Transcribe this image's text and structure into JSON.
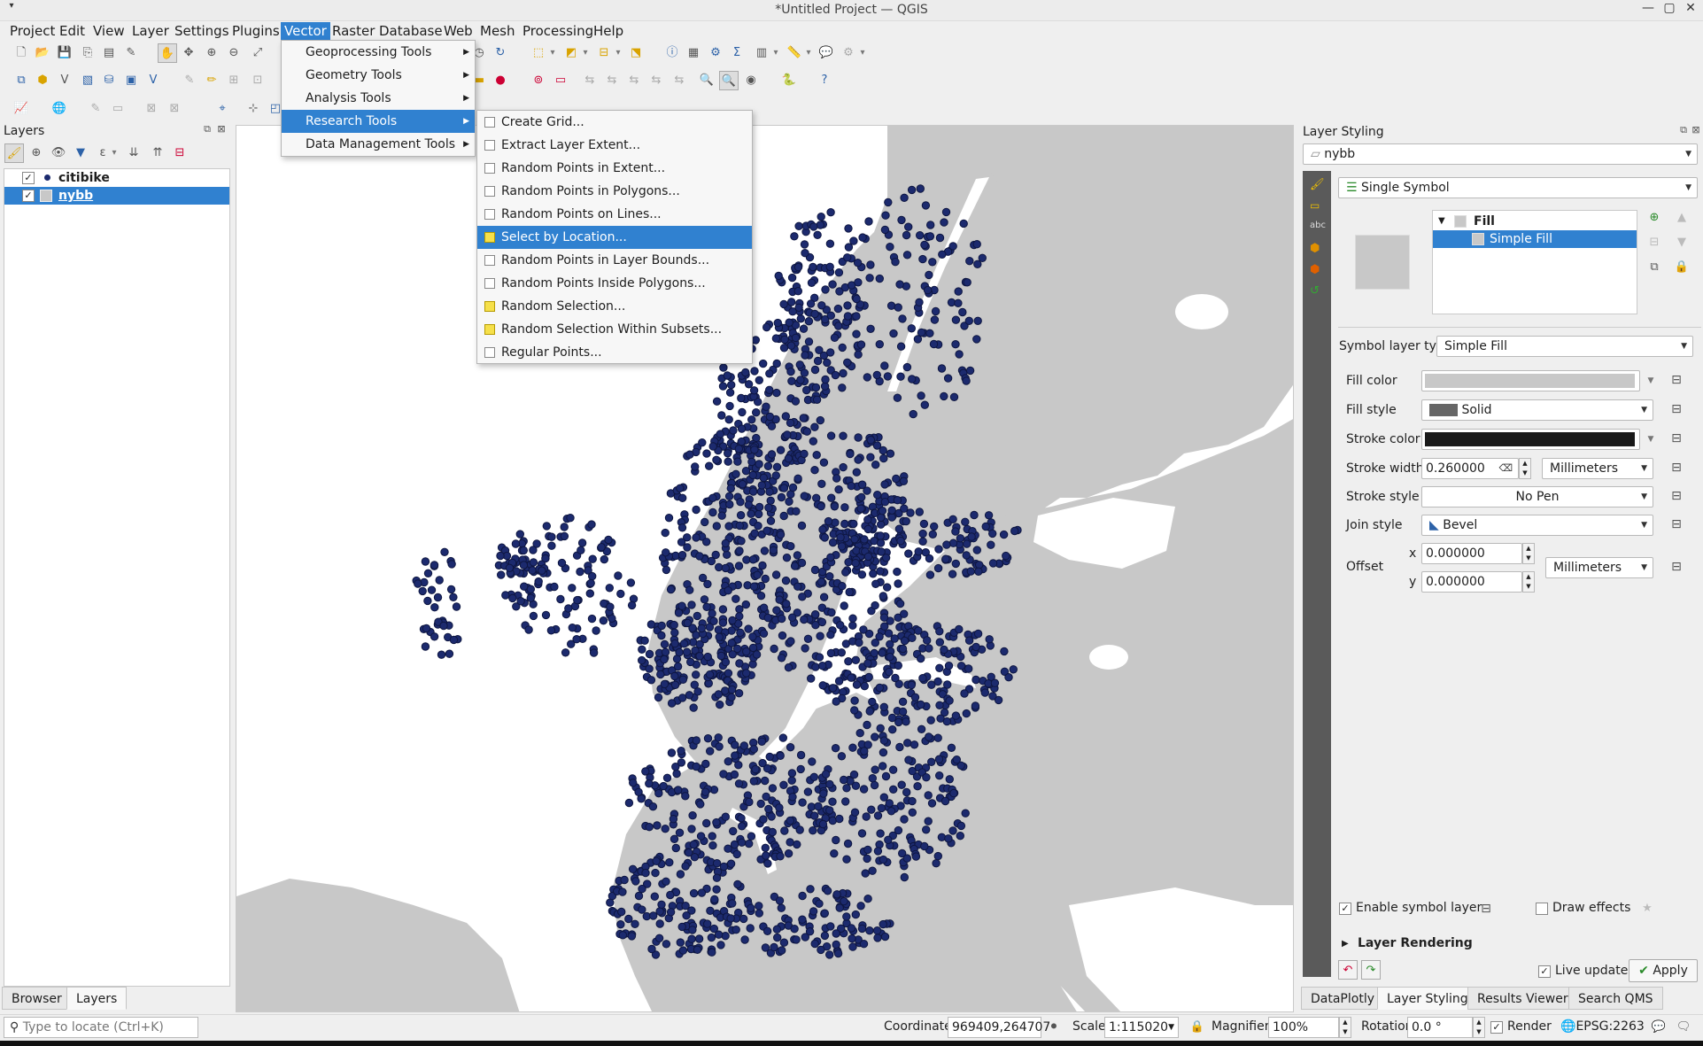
{
  "window": {
    "title": "*Untitled Project — QGIS",
    "menu_icon": "chevron-down-icon",
    "minimize": "—",
    "maximize": "▢",
    "close": "✕"
  },
  "menubar": [
    "Project",
    "Edit",
    "View",
    "Layer",
    "Settings",
    "Plugins",
    "Vector",
    "Raster",
    "Database",
    "Web",
    "Mesh",
    "Processing",
    "Help"
  ],
  "vector_menu": {
    "items": [
      "Geoprocessing Tools",
      "Geometry Tools",
      "Analysis Tools",
      "Research Tools",
      "Data Management Tools"
    ],
    "highlighted": "Research Tools"
  },
  "research_submenu": {
    "items": [
      "Create Grid...",
      "Extract Layer Extent...",
      "Random Points in Extent...",
      "Random Points in Polygons...",
      "Random Points on Lines...",
      "Select by Location...",
      "Random Points in Layer Bounds...",
      "Random Points Inside Polygons...",
      "Random Selection...",
      "Random Selection Within Subsets...",
      "Regular Points..."
    ],
    "highlighted": "Select by Location..."
  },
  "layers_panel": {
    "title": "Layers",
    "layers": [
      {
        "name": "citibike",
        "checked": true,
        "selected": false,
        "symbol": "point-icon"
      },
      {
        "name": "nybb",
        "checked": true,
        "selected": true,
        "symbol": "polygon-icon"
      }
    ],
    "tabs": [
      "Browser",
      "Layers"
    ],
    "active_tab": "Layers"
  },
  "layer_styling": {
    "title": "Layer Styling",
    "layer": "nybb",
    "renderer": "Single Symbol",
    "symbol_tree": {
      "root": "Fill",
      "child": "Simple Fill"
    },
    "symbol_layer_type_label": "Symbol layer type",
    "symbol_layer_type": "Simple Fill",
    "fill_color_label": "Fill color",
    "fill_style_label": "Fill style",
    "fill_style": "Solid",
    "stroke_color_label": "Stroke color",
    "stroke_width_label": "Stroke width",
    "stroke_width": "0.260000",
    "stroke_width_unit": "Millimeters",
    "stroke_style_label": "Stroke style",
    "stroke_style": "No Pen",
    "join_style_label": "Join style",
    "join_style": "Bevel",
    "offset_label": "Offset",
    "offset_x_label": "x",
    "offset_x": "0.000000",
    "offset_y_label": "y",
    "offset_y": "0.000000",
    "offset_unit": "Millimeters",
    "enable_symbol_layer_label": "Enable symbol layer",
    "draw_effects_label": "Draw effects",
    "layer_rendering_label": "Layer Rendering",
    "live_update_label": "Live update",
    "apply_label": "Apply",
    "fill_color": "#c8c8c8",
    "stroke_color": "#1a1a1a"
  },
  "right_tabs": [
    "DataPlotly",
    "Layer Styling",
    "Results Viewer",
    "Search QMS"
  ],
  "right_active_tab": "Layer Styling",
  "statusbar": {
    "locate_placeholder": "Type to locate (Ctrl+K)",
    "coordinate_label": "Coordinate",
    "coordinate": "969409,264707",
    "scale_label": "Scale",
    "scale": "1:115020",
    "magnifier_label": "Magnifier",
    "magnifier": "100%",
    "rotation_label": "Rotation",
    "rotation": "0.0 °",
    "render_label": "Render",
    "crs": "EPSG:2263"
  },
  "map_colors": {
    "land": "#c8c8c8",
    "water": "#ffffff",
    "points": "#1c2a6e"
  }
}
